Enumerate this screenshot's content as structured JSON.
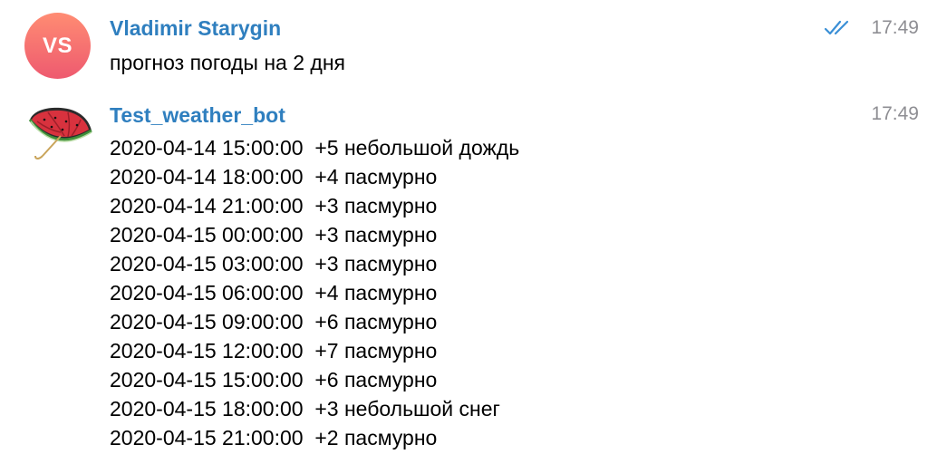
{
  "messages": [
    {
      "sender": "Vladimir Starygin",
      "avatar_initials": "VS",
      "time": "17:49",
      "status_icon": "double-check-read-icon",
      "text": "прогноз погоды на 2 дня"
    },
    {
      "sender": "Test_weather_bot",
      "avatar_icon": "umbrella-icon",
      "time": "17:49",
      "lines": [
        "2020-04-14 15:00:00  +5 небольшой дождь",
        "2020-04-14 18:00:00  +4 пасмурно",
        "2020-04-14 21:00:00  +3 пасмурно",
        "2020-04-15 00:00:00  +3 пасмурно",
        "2020-04-15 03:00:00  +3 пасмурно",
        "2020-04-15 06:00:00  +4 пасмурно",
        "2020-04-15 09:00:00  +6 пасмурно",
        "2020-04-15 12:00:00  +7 пасмурно",
        "2020-04-15 15:00:00  +6 пасмурно",
        "2020-04-15 18:00:00  +3 небольшой снег",
        "2020-04-15 21:00:00  +2 пасмурно"
      ]
    }
  ],
  "colors": {
    "sender_name": "#2f7fbf",
    "timestamp": "#8e8e93",
    "read_check": "#3a8fd6",
    "avatar_gradient_top": "#ff8c73",
    "avatar_gradient_bottom": "#ee5a6f"
  }
}
